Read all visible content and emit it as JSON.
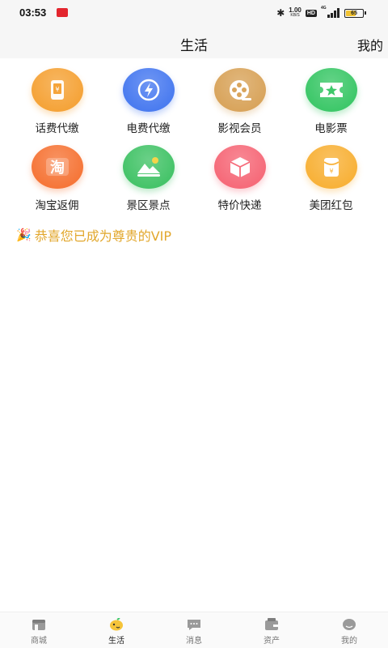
{
  "status_bar": {
    "time": "03:53",
    "net_speed_value": "1.00",
    "net_speed_unit": "KB/S",
    "hd_label": "HD",
    "network_type": "4G",
    "battery_level": "65"
  },
  "header": {
    "title": "生活",
    "right_action": "我的"
  },
  "services": [
    {
      "label": "话费代缴",
      "icon": "phone-bill-icon",
      "color": "#f5a43a"
    },
    {
      "label": "电费代缴",
      "icon": "electricity-icon",
      "color": "#4b7cf0"
    },
    {
      "label": "影视会员",
      "icon": "film-reel-icon",
      "color": "#d9a55d"
    },
    {
      "label": "电影票",
      "icon": "movie-ticket-icon",
      "color": "#3ec86a"
    },
    {
      "label": "淘宝返佣",
      "icon": "taobao-icon",
      "color": "#f6773a"
    },
    {
      "label": "景区景点",
      "icon": "scenery-icon",
      "color": "#46c46a"
    },
    {
      "label": "特价快递",
      "icon": "package-icon",
      "color": "#f66b7a"
    },
    {
      "label": "美团红包",
      "icon": "red-envelope-icon",
      "color": "#f8b23a"
    }
  ],
  "vip_message": {
    "emoji": "🎉",
    "text": "恭喜您已成为尊贵的VIP",
    "color": "#e2a72c"
  },
  "bottom_nav": {
    "items": [
      {
        "label": "商城",
        "icon": "store-icon",
        "active": false
      },
      {
        "label": "生活",
        "icon": "life-icon",
        "active": true
      },
      {
        "label": "消息",
        "icon": "message-icon",
        "active": false
      },
      {
        "label": "资产",
        "icon": "wallet-icon",
        "active": false
      },
      {
        "label": "我的",
        "icon": "profile-icon",
        "active": false
      }
    ]
  }
}
